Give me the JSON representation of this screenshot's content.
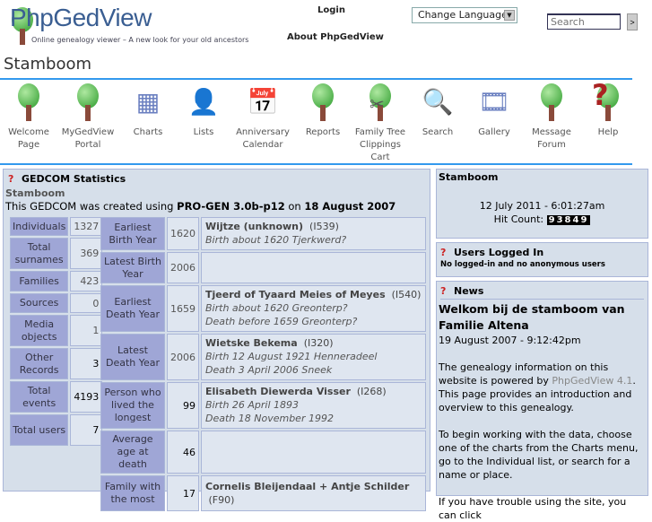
{
  "header": {
    "logo_title": "PhpGedView",
    "logo_tagline": "Online genealogy viewer – A new look for your old ancestors",
    "login": "Login",
    "about": "About PhpGedView",
    "language_select": "Change Language",
    "search_placeholder": "Search",
    "search_button": ">"
  },
  "page_title": "Stamboom",
  "menu": [
    {
      "label": "Welcome Page",
      "icon": "tree-icon"
    },
    {
      "label": "MyGedView Portal",
      "icon": "tree-icon"
    },
    {
      "label": "Charts",
      "icon": "charts-icon"
    },
    {
      "label": "Lists",
      "icon": "person-icon"
    },
    {
      "label": "Anniversary Calendar",
      "icon": "calendar-icon"
    },
    {
      "label": "Reports",
      "icon": "reports-icon"
    },
    {
      "label": "Family Tree Clippings Cart",
      "icon": "scissors-icon"
    },
    {
      "label": "Search",
      "icon": "magnifier-icon"
    },
    {
      "label": "Gallery",
      "icon": "gallery-icon"
    },
    {
      "label": "Message Forum",
      "icon": "forum-icon"
    },
    {
      "label": "Help",
      "icon": "help-icon"
    }
  ],
  "stats": {
    "title": "GEDCOM Statistics",
    "subtitle": "Stamboom",
    "created_prefix": "This GEDCOM was created using ",
    "software": "PRO-GEN 3.0b-p12",
    "created_on": " on ",
    "date": "18 August 2007",
    "left": [
      {
        "label": "Individuals",
        "value": "1327"
      },
      {
        "label": "Total surnames",
        "value": "369"
      },
      {
        "label": "Families",
        "value": "423"
      },
      {
        "label": "Sources",
        "value": "0"
      },
      {
        "label": "Media objects",
        "value": "1"
      },
      {
        "label": "Other Records",
        "value": "3"
      },
      {
        "label": "Total events",
        "value": "4193"
      },
      {
        "label": "Total users",
        "value": "7"
      }
    ],
    "right": [
      {
        "label": "Earliest Birth Year",
        "value": "1620",
        "name": "Wijtze (unknown)",
        "id": "(I539)",
        "lines": [
          "Birth about 1620 Tjerkwerd?"
        ]
      },
      {
        "label": "Latest Birth Year",
        "value": "2006",
        "name": "",
        "id": "",
        "lines": []
      },
      {
        "label": "Earliest Death Year",
        "value": "1659",
        "name": "Tjeerd of Tyaard Meies of Meyes",
        "id": "(I540)",
        "lines": [
          "Birth about 1620 Greonterp?",
          "Death before 1659 Greonterp?"
        ]
      },
      {
        "label": "Latest Death Year",
        "value": "2006",
        "name": "Wietske Bekema",
        "id": "(I320)",
        "lines": [
          "Birth 12 August 1921 Henneradeel",
          "Death 3 April 2006 Sneek"
        ]
      },
      {
        "label": "Person who lived the longest",
        "value": "99",
        "name": "Elisabeth Diewerda Visser",
        "id": "(I268)",
        "lines": [
          "Birth 26 April 1893",
          "Death 18 November 1992"
        ]
      },
      {
        "label": "Average age at death",
        "value": "46",
        "name": "",
        "id": "",
        "lines": []
      },
      {
        "label": "Family with the most",
        "value": "17",
        "name": "Cornelis Bleijendaal + Antje Schilder",
        "id": "(F90)",
        "lines": []
      }
    ]
  },
  "info": {
    "title": "Stamboom",
    "datetime": "12 July 2011 - 6:01:27am",
    "hit_label": "Hit Count:",
    "hit_count": "93849"
  },
  "users": {
    "title": "Users Logged In",
    "text": "No logged-in and no anonymous users"
  },
  "news": {
    "title": "News",
    "headline": "Welkom bij de stamboom van Familie Altena",
    "date": "19 August 2007 - 9:12:42pm",
    "p1a": "The genealogy information on this website is powered by ",
    "p1link": "PhpGedView 4.1",
    "p1b": ". This page provides an introduction and overview to this genealogy.",
    "p2": "To begin working with the data, choose one of the charts from the Charts menu, go to the Individual list, or search for a name or place.",
    "p3": "If you have trouble using the site, you can click"
  }
}
